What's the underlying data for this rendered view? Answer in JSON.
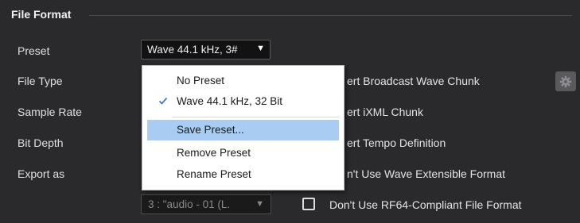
{
  "section": {
    "title": "File Format"
  },
  "rows": {
    "preset": "Preset",
    "file_type": "File Type",
    "sample_rate": "Sample Rate",
    "bit_depth": "Bit Depth",
    "export_as": "Export as"
  },
  "preset_field": {
    "value": "Wave 44.1 kHz, 3#",
    "arrow": "▼"
  },
  "dropdown": {
    "items": [
      {
        "label": "No Preset",
        "checked": false
      },
      {
        "label": "Wave 44.1 kHz, 32 Bit",
        "checked": true
      },
      {
        "label": "Save Preset...",
        "highlighted": true
      },
      {
        "label": "Remove Preset"
      },
      {
        "label": "Rename Preset"
      }
    ]
  },
  "options": {
    "broadcast": "ert Broadcast Wave Chunk",
    "ixml": "ert iXML Chunk",
    "tempo": "ert Tempo Definition",
    "wave_ext": "n't Use Wave Extensible Format",
    "rf64": "Don't Use RF64-Compliant File Format"
  },
  "channel_field": {
    "value": "3 : \"audio - 01 (L.",
    "arrow": "▼"
  },
  "icons": {
    "gear": "gear-icon",
    "check": "checkmark-icon"
  },
  "colors": {
    "highlight": "#a9cdf2",
    "checkmark": "#2f6fb5",
    "background": "#2a2a2c"
  }
}
